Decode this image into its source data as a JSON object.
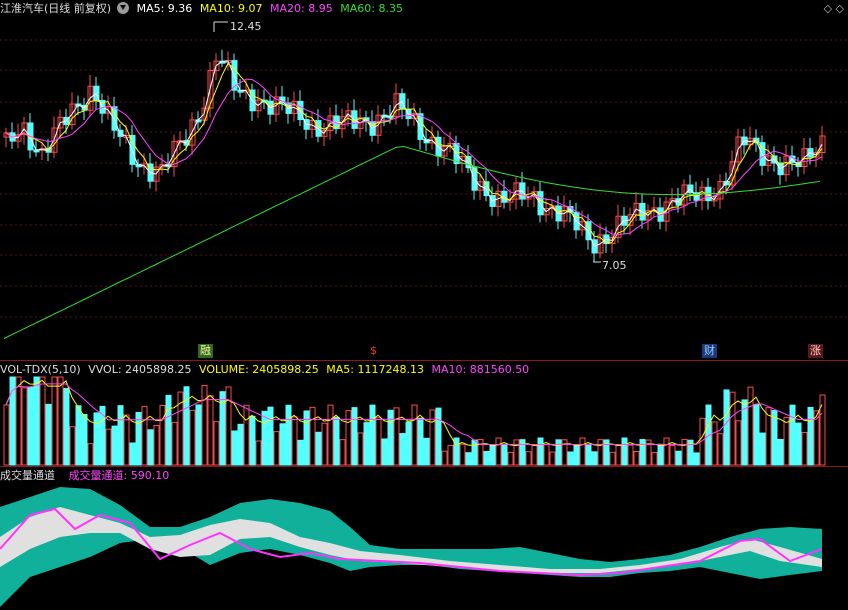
{
  "kline": {
    "title": "江淮汽车(日线 前复权)",
    "ma5": "MA5: 9.36",
    "ma10": "MA10: 9.07",
    "ma20": "MA20: 8.95",
    "ma60": "MA60: 8.35",
    "high_label": "12.45",
    "low_label": "7.05",
    "markers": [
      "融",
      "$",
      "财",
      "涨"
    ]
  },
  "volume": {
    "name": "VOL-TDX(5,10)",
    "vvol": "VVOL: 2405898.25",
    "volume": "VOLUME: 2405898.25",
    "ma5": "MA5: 1117248.13",
    "ma10": "MA10: 881560.50"
  },
  "channel": {
    "name": "成交量通道",
    "value": "成交量通道: 590.10"
  },
  "colors": {
    "up": "#ff4a4a",
    "down": "#54ffff",
    "ma5": "#ffffff",
    "ma10": "#ffff00",
    "ma20": "#ff44ff",
    "ma60": "#33dd33",
    "channel_fill": "#10b09a",
    "channel_inner": "#e0e0e0"
  },
  "icons": [
    "dropdown-icon",
    "diamond-icon",
    "expand-icon"
  ]
}
